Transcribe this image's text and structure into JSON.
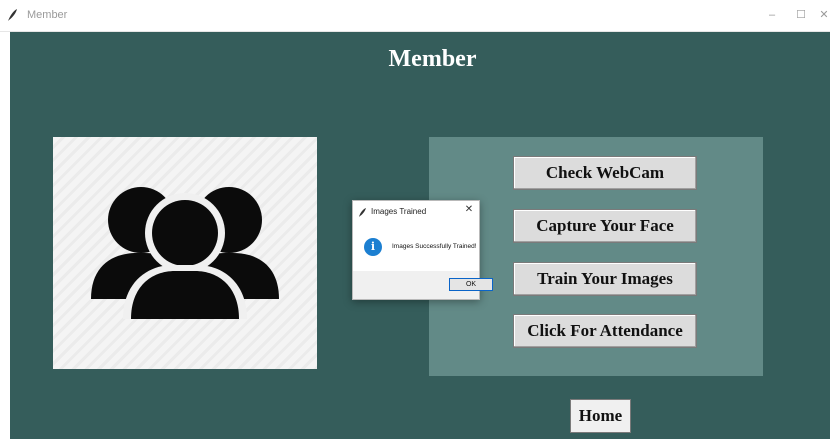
{
  "window": {
    "title": "Member",
    "minimize_glyph": "–",
    "maximize_glyph": "☐",
    "close_glyph": "✕"
  },
  "page": {
    "title": "Member"
  },
  "image_panel": {
    "icon": "users-group-icon"
  },
  "actions": {
    "check_webcam": "Check WebCam",
    "capture_face": "Capture Your Face",
    "train_images": "Train Your Images",
    "attendance": "Click For Attendance"
  },
  "home_label": "Home",
  "dialog": {
    "title": "Images Trained",
    "message": "Images Successfully Trained!",
    "ok_label": "OK",
    "close_glyph": "✕",
    "icon": "info-icon"
  },
  "colors": {
    "background": "#355d5b",
    "button_panel": "#628a87",
    "info_blue": "#1c7fd1"
  }
}
